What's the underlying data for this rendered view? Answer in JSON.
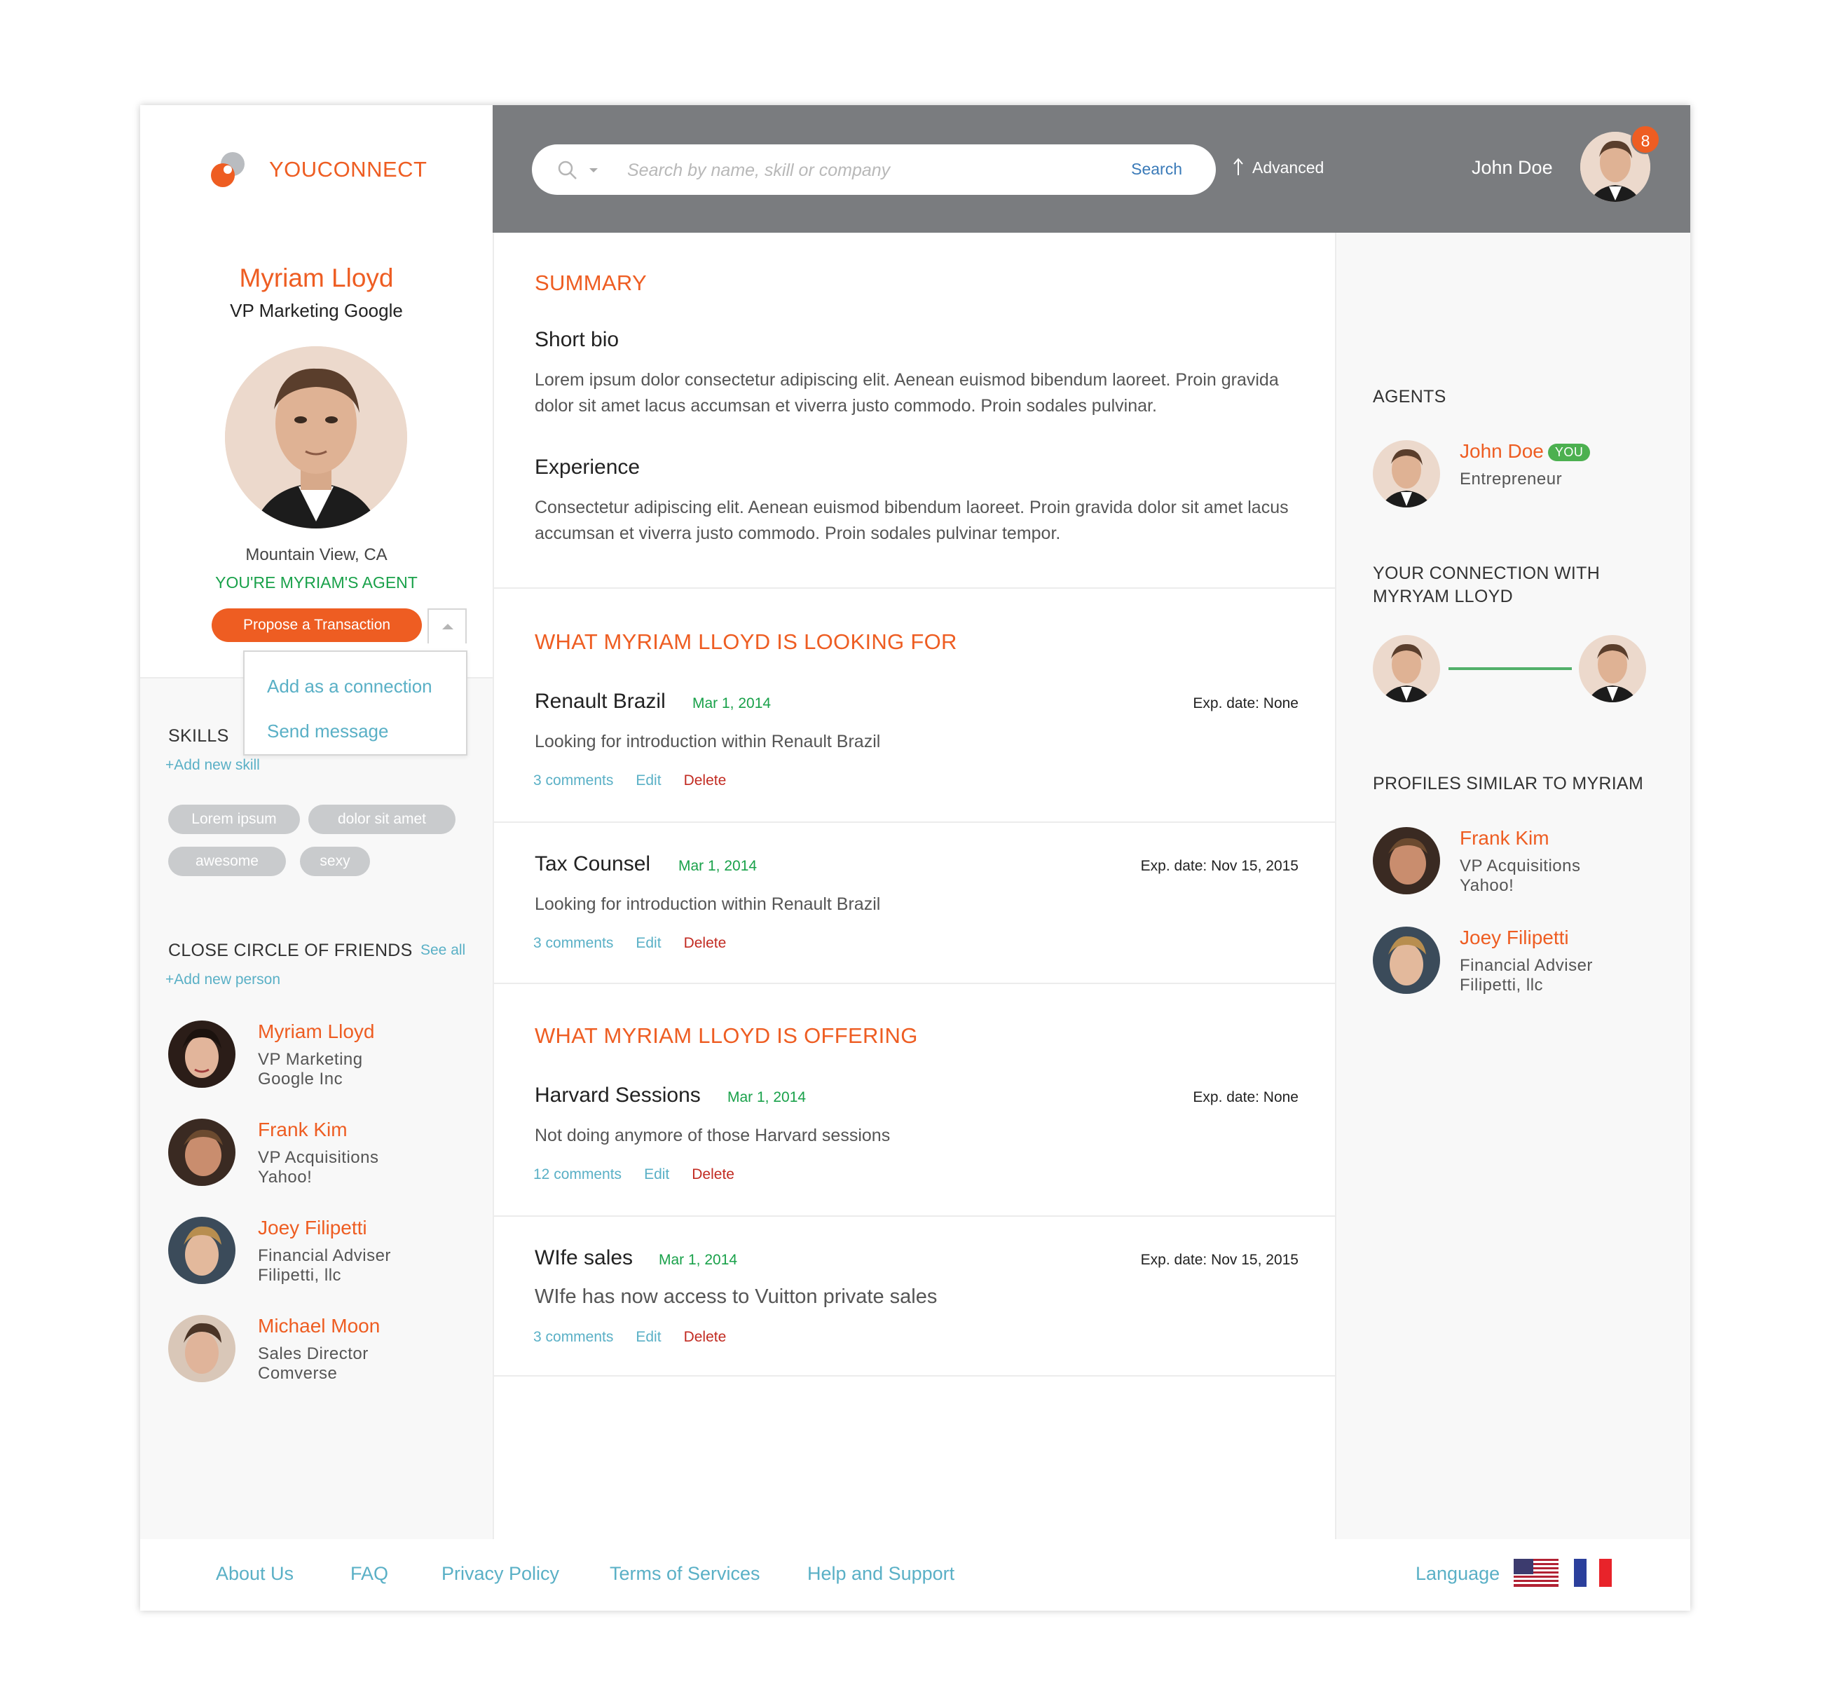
{
  "brand": {
    "name": "YOUCONNECT",
    "accent": "#ee5d22",
    "link_color": "#5ab0c6",
    "success_color": "#19a14a"
  },
  "topbar": {
    "search_placeholder": "Search by name, skill or company",
    "search_button": "Search",
    "advanced": "Advanced",
    "user_name": "John Doe",
    "notification_count": "8"
  },
  "profile": {
    "name": "Myriam Lloyd",
    "title": "VP Marketing Google",
    "location": "Mountain View, CA",
    "agent_status": "YOU'RE MYRIAM'S AGENT",
    "propose_button": "Propose a Transaction",
    "dropdown": [
      "Add as a connection",
      "Send message"
    ]
  },
  "skills": {
    "heading": "SKILLS",
    "add_link": "+Add new skill",
    "items": [
      "Lorem ipsum",
      "dolor sit amet",
      "awesome",
      "sexy"
    ]
  },
  "friends": {
    "heading": "CLOSE CIRCLE OF FRIENDS",
    "see_all": "See all",
    "add_link": "+Add new person",
    "people": [
      {
        "name": "Myriam Lloyd",
        "role": "VP Marketing",
        "org": "Google Inc"
      },
      {
        "name": "Frank Kim",
        "role": "VP Acquisitions",
        "org": "Yahoo!"
      },
      {
        "name": "Joey Filipetti",
        "role": "Financial Adviser",
        "org": "Filipetti, llc"
      },
      {
        "name": "Michael Moon",
        "role": "Sales Director",
        "org": "Comverse"
      }
    ]
  },
  "summary": {
    "heading": "SUMMARY",
    "bio_heading": "Short bio",
    "bio": "Lorem ipsum dolor consectetur adipiscing elit. Aenean euismod bibendum laoreet. Proin gravida dolor sit amet lacus accumsan et viverra justo commodo. Proin sodales pulvinar.",
    "exp_heading": "Experience",
    "experience": "Consectetur adipiscing elit. Aenean euismod bibendum laoreet. Proin gravida dolor sit amet lacus accumsan et viverra justo commodo. Proin sodales pulvinar tempor."
  },
  "looking_for": {
    "heading": "WHAT MYRIAM LLOYD IS LOOKING FOR",
    "items": [
      {
        "title": "Renault Brazil",
        "date": "Mar 1, 2014",
        "exp": "Exp. date: None",
        "desc": "Looking for introduction within Renault Brazil",
        "comments": "3 comments",
        "edit": "Edit",
        "delete": "Delete"
      },
      {
        "title": "Tax Counsel",
        "date": "Mar 1, 2014",
        "exp": "Exp. date: Nov 15, 2015",
        "desc": "Looking for introduction within Renault Brazil",
        "comments": "3 comments",
        "edit": "Edit",
        "delete": "Delete"
      }
    ]
  },
  "offering": {
    "heading": "WHAT MYRIAM LLOYD IS OFFERING",
    "items": [
      {
        "title": "Harvard Sessions",
        "date": "Mar 1, 2014",
        "exp": "Exp. date: None",
        "desc": "Not doing anymore of those Harvard sessions",
        "comments": "12 comments",
        "edit": "Edit",
        "delete": "Delete"
      },
      {
        "title": "WIfe sales",
        "date": "Mar 1, 2014",
        "exp": "Exp. date: Nov 15, 2015",
        "desc": "WIfe has now access to Vuitton private sales",
        "comments": "3 comments",
        "edit": "Edit",
        "delete": "Delete"
      }
    ]
  },
  "agents": {
    "heading": "AGENTS",
    "name": "John Doe",
    "badge": "YOU",
    "role": "Entrepreneur"
  },
  "connection": {
    "heading": "YOUR CONNECTION WITH MYRYAM LLOYD"
  },
  "similar": {
    "heading": "PROFILES SIMILAR TO MYRIAM",
    "people": [
      {
        "name": "Frank Kim",
        "role": "VP Acquisitions",
        "org": "Yahoo!"
      },
      {
        "name": "Joey Filipetti",
        "role": "Financial Adviser",
        "org": "Filipetti, llc"
      }
    ]
  },
  "footer": {
    "links": [
      "About Us",
      "FAQ",
      "Privacy Policy",
      "Terms of Services",
      "Help and Support"
    ],
    "language": "Language"
  }
}
